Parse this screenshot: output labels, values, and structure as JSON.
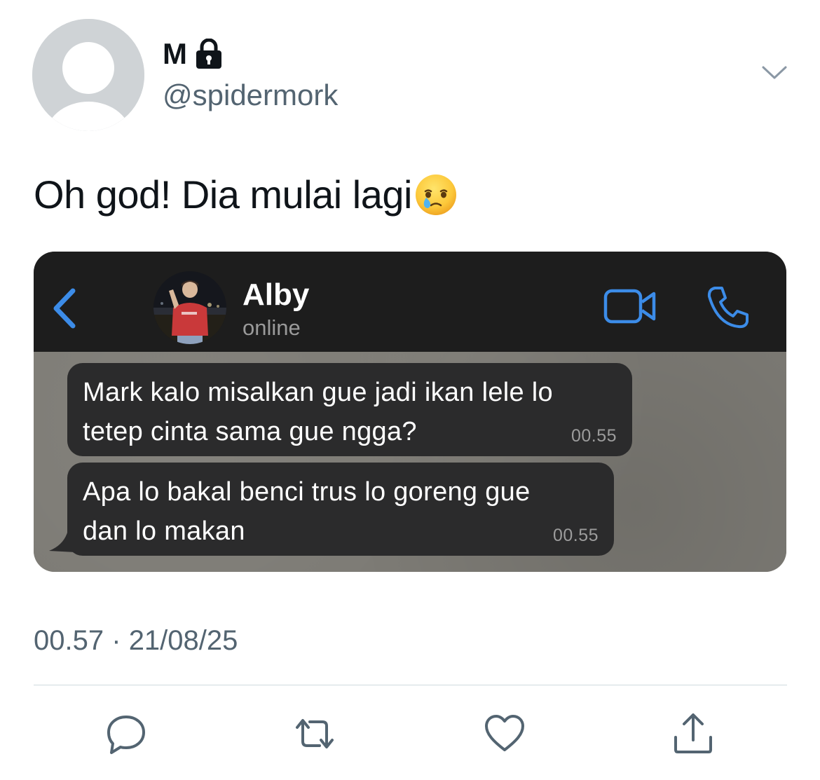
{
  "tweet": {
    "display_name": "M",
    "handle": "@spidermork",
    "text": "Oh god! Dia mulai lagi",
    "emoji": "face-holding-back-tears",
    "time": "00.57",
    "separator": "·",
    "date": "21/08/25"
  },
  "chat": {
    "contact_name": "Alby",
    "contact_status": "online",
    "messages": [
      {
        "text": "Mark kalo misalkan gue jadi ikan lele lo\ntetep cinta sama gue ngga?",
        "time": "00.55"
      },
      {
        "text": "Apa lo bakal benci trus lo goreng gue\ndan lo makan",
        "time": "00.55"
      }
    ]
  },
  "colors": {
    "accent_blue": "#3c8ce8",
    "muted_gray": "#536471",
    "chat_header_bg": "#1d1d1d",
    "bubble_bg": "#2b2b2c"
  },
  "icons": {
    "lock": "lock-icon",
    "caret": "chevron-down-icon",
    "back": "chevron-left-icon",
    "video": "video-camera-icon",
    "phone": "phone-icon",
    "reply": "reply-icon",
    "retweet": "retweet-icon",
    "like": "heart-icon",
    "share": "share-icon"
  }
}
